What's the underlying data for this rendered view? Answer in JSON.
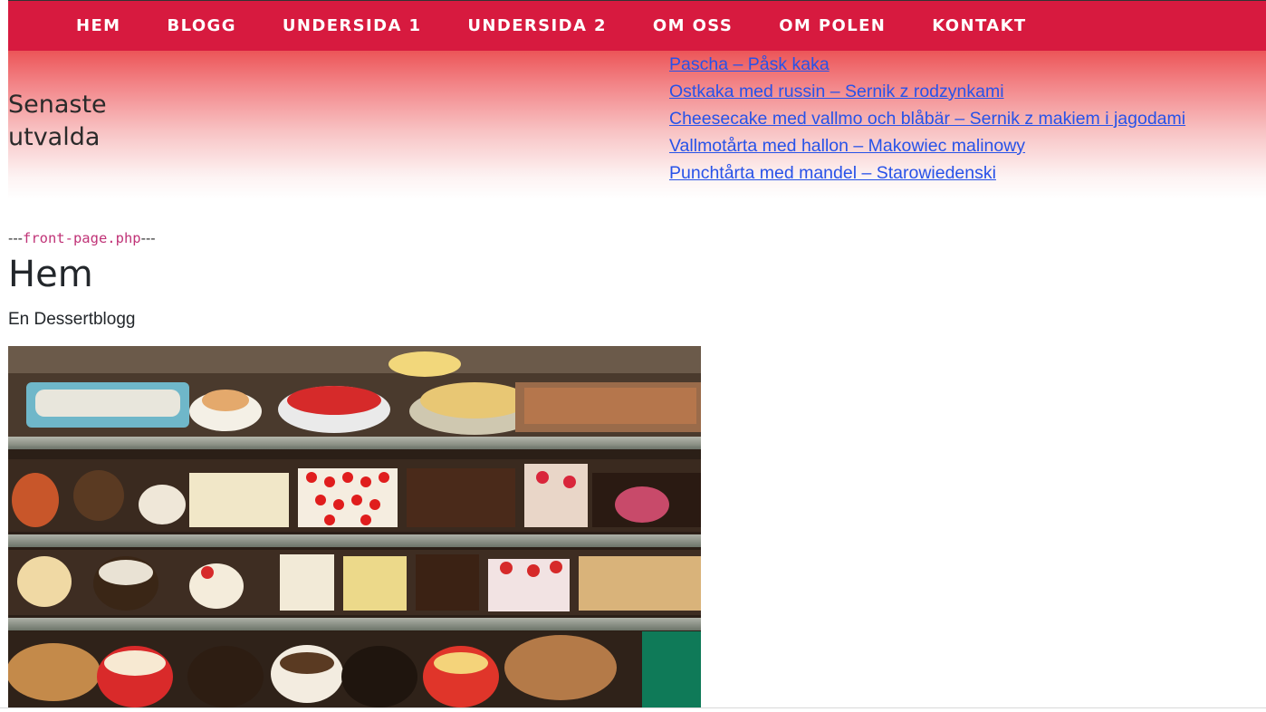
{
  "nav": {
    "items": [
      {
        "label": "HEM"
      },
      {
        "label": "BLOGG"
      },
      {
        "label": "UNDERSIDA 1"
      },
      {
        "label": "UNDERSIDA 2"
      },
      {
        "label": "OM OSS"
      },
      {
        "label": "OM POLEN"
      },
      {
        "label": "KONTAKT"
      }
    ]
  },
  "featured": {
    "heading": "Senaste utvalda",
    "links": [
      {
        "label": "Pascha – Påsk kaka"
      },
      {
        "label": "Ostkaka med russin – Sernik z rodzynkami"
      },
      {
        "label": "Cheesecake med vallmo och blåbär – Sernik z makiem i jagodami"
      },
      {
        "label": "Vallmotårta med hallon – Makowiec malinowy"
      },
      {
        "label": "Punchtårta med mandel – Starowiedenski"
      }
    ]
  },
  "main": {
    "debug_prefix": "---",
    "debug_file": "front-page.php",
    "debug_suffix": "---",
    "title": "Hem",
    "tagline": "En Dessertblogg"
  },
  "colors": {
    "nav_bg": "#d71a3f",
    "link": "#2752e8"
  }
}
